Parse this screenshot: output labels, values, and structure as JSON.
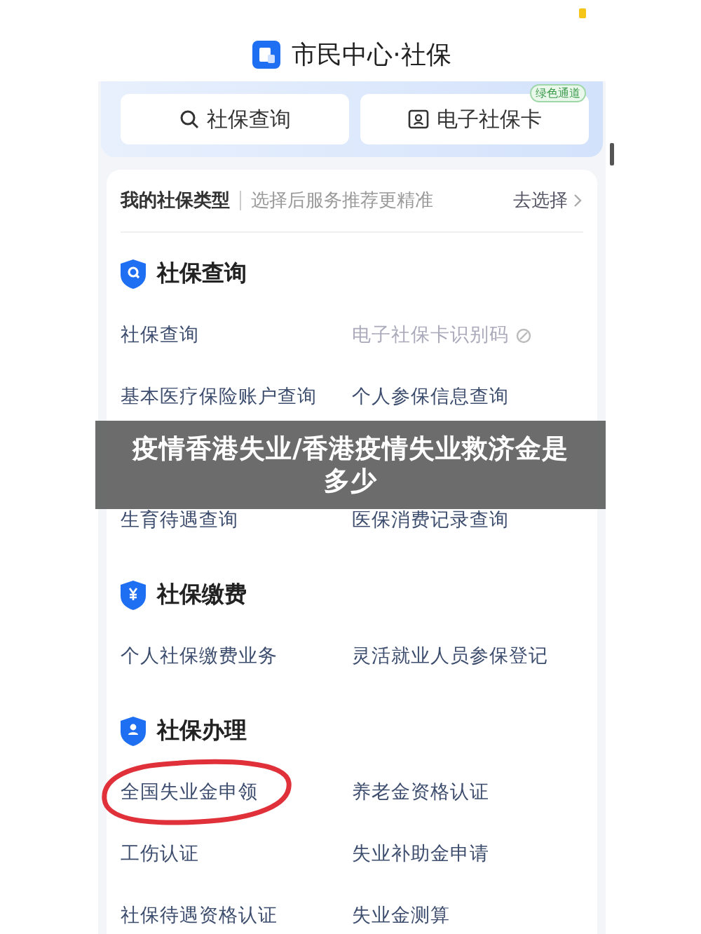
{
  "header": {
    "title": "市民中心·社保"
  },
  "quick_actions": [
    {
      "label": "社保查询"
    },
    {
      "label": "电子社保卡",
      "badge": "绿色通道"
    }
  ],
  "type_bar": {
    "title": "我的社保类型",
    "hint": "选择后服务推荐更精准",
    "action": "去选择"
  },
  "sections": [
    {
      "title": "社保查询",
      "rows": [
        [
          {
            "label": "社保查询",
            "disabled": false
          },
          {
            "label": "电子社保卡识别码",
            "disabled": true
          }
        ],
        [
          {
            "label": "基本医疗保险账户查询",
            "disabled": false
          },
          {
            "label": "个人参保信息查询",
            "disabled": false
          }
        ],
        [],
        [
          {
            "label": "生育待遇查询",
            "disabled": false
          },
          {
            "label": "医保消费记录查询",
            "disabled": false
          }
        ]
      ]
    },
    {
      "title": "社保缴费",
      "rows": [
        [
          {
            "label": "个人社保缴费业务",
            "disabled": false
          },
          {
            "label": "灵活就业人员参保登记",
            "disabled": false
          }
        ]
      ]
    },
    {
      "title": "社保办理",
      "rows": [
        [
          {
            "label": "全国失业金申领",
            "disabled": false,
            "circled": true
          },
          {
            "label": "养老金资格认证",
            "disabled": false
          }
        ],
        [
          {
            "label": "工伤认证",
            "disabled": false
          },
          {
            "label": "失业补助金申请",
            "disabled": false
          }
        ],
        [
          {
            "label": "社保待遇资格认证",
            "disabled": false
          },
          {
            "label": "失业金测算",
            "disabled": false
          }
        ]
      ]
    }
  ],
  "banner": {
    "text": "疫情香港失业/香港疫情失业救济金是多少"
  }
}
